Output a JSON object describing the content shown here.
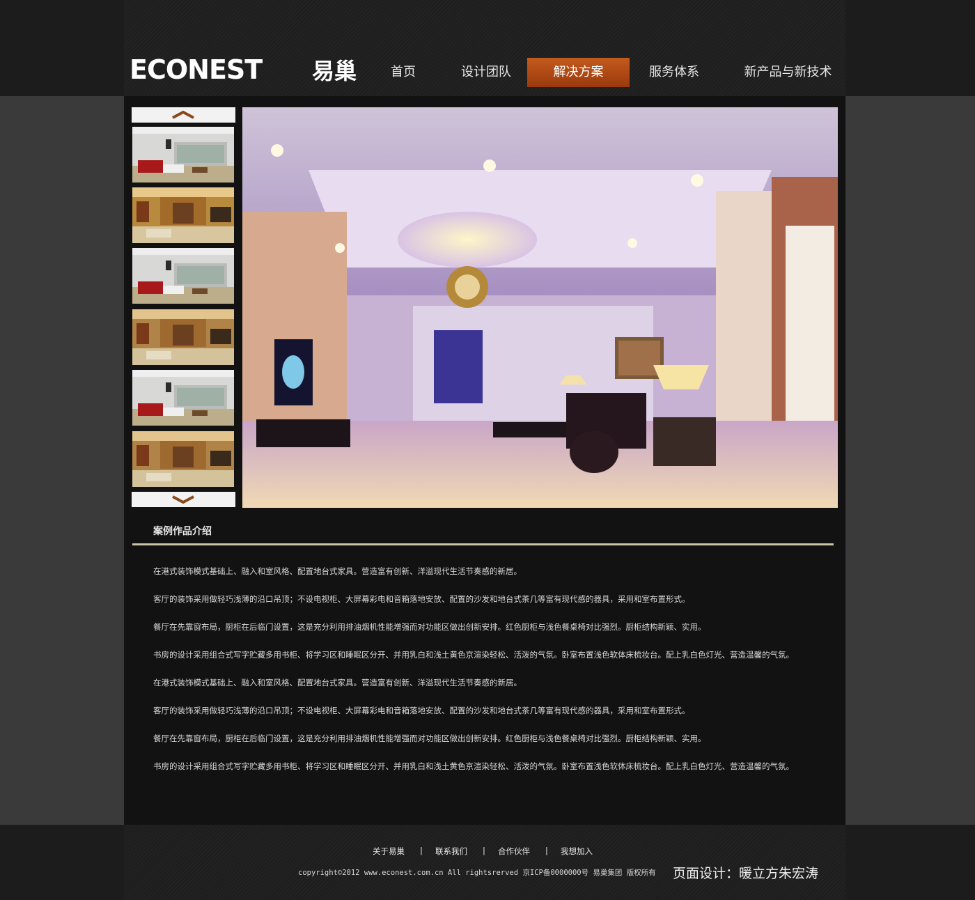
{
  "brand": {
    "logo_text": "ECONEST",
    "logo_cn": "易巢"
  },
  "nav": {
    "items": [
      {
        "label": "首页"
      },
      {
        "label": "设计团队"
      },
      {
        "label": "解决方案"
      },
      {
        "label": "服务体系"
      },
      {
        "label": "新产品与新技术"
      }
    ],
    "active_index": 2,
    "active_color": "#b84a14"
  },
  "gallery": {
    "up_icon": "chevron-up-icon",
    "down_icon": "chevron-down-icon",
    "thumbnails": [
      "white-red-living-room",
      "warm-living-room",
      "white-red-living-room",
      "warm-living-room",
      "white-red-living-room",
      "warm-living-room"
    ],
    "main_image": "purple-lit-living-room"
  },
  "section": {
    "title": "案例作品介绍",
    "paragraphs": [
      "在港式装饰模式基础上、融入和室风格、配置地台式家具。营造富有创新、洋溢现代生活节奏感的新居。",
      "客厅的装饰采用做轻巧浅薄的沿口吊顶；不设电视柜、大屏幕彩电和音箱落地安放、配置的沙发和地台式茶几等富有现代感的器具，采用和室布置形式。",
      "餐厅在先靠窗布局，厨柜在后临门设置，这是充分利用排油烟机性能增强而对功能区做出创新安排。红色厨柜与浅色餐桌椅对比强烈。厨柜结构新颖、实用。",
      "书房的设计采用组合式写字贮藏多用书柜、将学习区和睡眠区分开、并用乳白和浅土黄色京渲染轻松、活泼的气氛。卧室布置浅色软体床梳妆台。配上乳白色灯光、营造温馨的气氛。",
      "在港式装饰模式基础上、融入和室风格、配置地台式家具。营造富有创新、洋溢现代生活节奏感的新居。",
      "客厅的装饰采用做轻巧浅薄的沿口吊顶；不设电视柜、大屏幕彩电和音箱落地安放、配置的沙发和地台式茶几等富有现代感的器具，采用和室布置形式。",
      "餐厅在先靠窗布局，厨柜在后临门设置，这是充分利用排油烟机性能增强而对功能区做出创新安排。红色厨柜与浅色餐桌椅对比强烈。厨柜结构新颖、实用。",
      "书房的设计采用组合式写字贮藏多用书柜、将学习区和睡眠区分开、并用乳白和浅土黄色京渲染轻松、活泼的气氛。卧室布置浅色软体床梳妆台。配上乳白色灯光、营造温馨的气氛。"
    ]
  },
  "footer": {
    "links": [
      {
        "label": "关于易巢"
      },
      {
        "label": "联系我们"
      },
      {
        "label": "合作伙伴"
      },
      {
        "label": "我想加入"
      }
    ],
    "separator": "|",
    "copyright": "copyright©2012 www.econest.com.cn All rightsrerved 京ICP备0000000号 易巢集团 版权所有",
    "credit": "页面设计：暖立方朱宏涛"
  }
}
